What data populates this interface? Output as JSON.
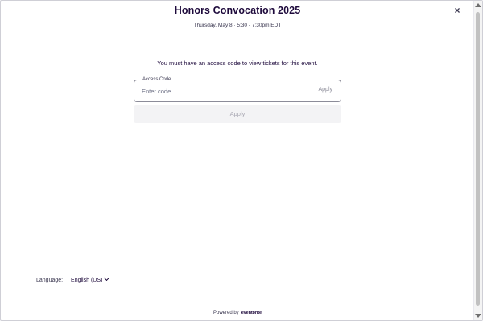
{
  "header": {
    "event_title": "Honors Convocation 2025",
    "event_date": "Thursday, May 8 · 5:30 - 7:30pm EDT",
    "close_icon": "close-icon",
    "close_glyph": "×"
  },
  "main": {
    "notice": "You must have an access code to view tickets for this event.",
    "access_code": {
      "label": "Access Code",
      "placeholder": "Enter code",
      "value": "",
      "inline_apply_label": "Apply"
    },
    "apply_button_label": "Apply",
    "apply_button_state": "disabled"
  },
  "footer": {
    "language_label": "Language:",
    "language_value": "English (US)",
    "powered_by": "Powered by",
    "brand": "eventbrite"
  },
  "colors": {
    "text_primary": "#1e0a3c",
    "text_secondary": "#39364f",
    "disabled_text": "#a9a8b3",
    "disabled_bg": "#f3f3f5",
    "border": "#8c8c99"
  }
}
